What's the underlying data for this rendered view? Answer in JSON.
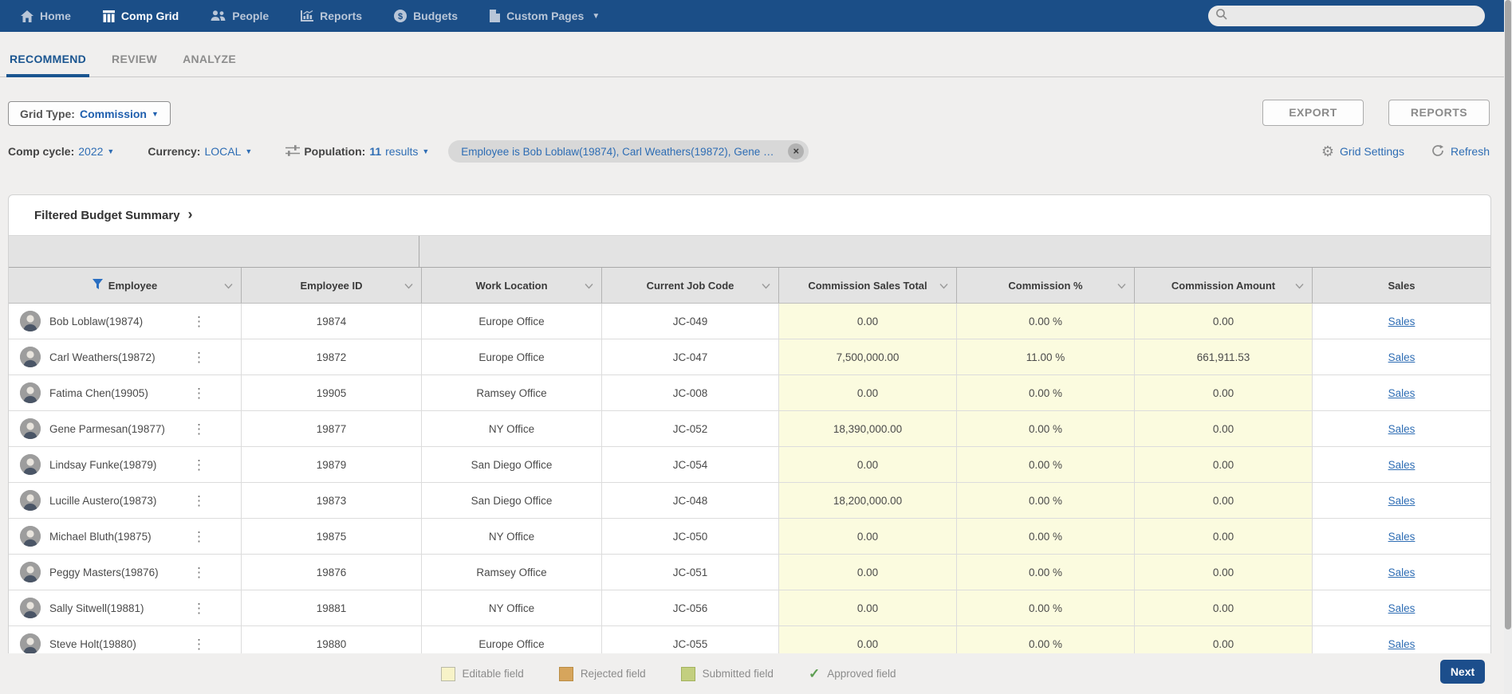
{
  "nav": {
    "items": [
      {
        "label": "Home",
        "icon": "home-icon",
        "active": false
      },
      {
        "label": "Comp Grid",
        "icon": "comp-grid-icon",
        "active": true
      },
      {
        "label": "People",
        "icon": "people-icon",
        "active": false
      },
      {
        "label": "Reports",
        "icon": "reports-icon",
        "active": false
      },
      {
        "label": "Budgets",
        "icon": "budgets-icon",
        "active": false
      },
      {
        "label": "Custom Pages",
        "icon": "custom-pages-icon",
        "active": false,
        "has_dropdown": true
      }
    ],
    "search": {
      "placeholder": "",
      "value": ""
    }
  },
  "tabs": [
    {
      "label": "RECOMMEND",
      "active": true
    },
    {
      "label": "REVIEW",
      "active": false
    },
    {
      "label": "ANALYZE",
      "active": false
    }
  ],
  "toolbar": {
    "grid_type_label": "Grid Type:",
    "grid_type_value": "Commission",
    "export_label": "EXPORT",
    "reports_label": "REPORTS"
  },
  "filters": {
    "comp_cycle_label": "Comp cycle:",
    "comp_cycle_value": "2022",
    "currency_label": "Currency:",
    "currency_value": "LOCAL",
    "population_label": "Population:",
    "population_count": "11",
    "population_results_word": "results",
    "chip_text": "Employee is Bob Loblaw(19874), Carl Weathers(19872), Gene Pa...",
    "chip_close": "×",
    "grid_settings_label": "Grid Settings",
    "refresh_label": "Refresh"
  },
  "summary": {
    "title": "Filtered Budget Summary",
    "chevron": "›"
  },
  "table": {
    "columns": [
      {
        "label": "Employee",
        "has_filter": true,
        "has_chevron": true
      },
      {
        "label": "Employee ID",
        "has_filter": false,
        "has_chevron": true
      },
      {
        "label": "Work Location",
        "has_filter": false,
        "has_chevron": true
      },
      {
        "label": "Current Job Code",
        "has_filter": false,
        "has_chevron": true
      },
      {
        "label": "Commission Sales Total",
        "has_filter": false,
        "has_chevron": true
      },
      {
        "label": "Commission %",
        "has_filter": false,
        "has_chevron": true
      },
      {
        "label": "Commission Amount",
        "has_filter": false,
        "has_chevron": true
      },
      {
        "label": "Sales",
        "has_filter": false,
        "has_chevron": false
      }
    ],
    "kebab_glyph": "⋮",
    "rows": [
      {
        "name": "Bob Loblaw(19874)",
        "id": "19874",
        "location": "Europe Office",
        "job_code": "JC-049",
        "sales_total": "0.00",
        "commission_pct": "0.00 %",
        "commission_amt": "0.00",
        "sales_label": "Sales"
      },
      {
        "name": "Carl Weathers(19872)",
        "id": "19872",
        "location": "Europe Office",
        "job_code": "JC-047",
        "sales_total": "7,500,000.00",
        "commission_pct": "11.00 %",
        "commission_amt": "661,911.53",
        "sales_label": "Sales"
      },
      {
        "name": "Fatima Chen(19905)",
        "id": "19905",
        "location": "Ramsey Office",
        "job_code": "JC-008",
        "sales_total": "0.00",
        "commission_pct": "0.00 %",
        "commission_amt": "0.00",
        "sales_label": "Sales"
      },
      {
        "name": "Gene Parmesan(19877)",
        "id": "19877",
        "location": "NY Office",
        "job_code": "JC-052",
        "sales_total": "18,390,000.00",
        "commission_pct": "0.00 %",
        "commission_amt": "0.00",
        "sales_label": "Sales"
      },
      {
        "name": "Lindsay Funke(19879)",
        "id": "19879",
        "location": "San Diego Office",
        "job_code": "JC-054",
        "sales_total": "0.00",
        "commission_pct": "0.00 %",
        "commission_amt": "0.00",
        "sales_label": "Sales"
      },
      {
        "name": "Lucille Austero(19873)",
        "id": "19873",
        "location": "San Diego Office",
        "job_code": "JC-048",
        "sales_total": "18,200,000.00",
        "commission_pct": "0.00 %",
        "commission_amt": "0.00",
        "sales_label": "Sales"
      },
      {
        "name": "Michael Bluth(19875)",
        "id": "19875",
        "location": "NY Office",
        "job_code": "JC-050",
        "sales_total": "0.00",
        "commission_pct": "0.00 %",
        "commission_amt": "0.00",
        "sales_label": "Sales"
      },
      {
        "name": "Peggy Masters(19876)",
        "id": "19876",
        "location": "Ramsey Office",
        "job_code": "JC-051",
        "sales_total": "0.00",
        "commission_pct": "0.00 %",
        "commission_amt": "0.00",
        "sales_label": "Sales"
      },
      {
        "name": "Sally Sitwell(19881)",
        "id": "19881",
        "location": "NY Office",
        "job_code": "JC-056",
        "sales_total": "0.00",
        "commission_pct": "0.00 %",
        "commission_amt": "0.00",
        "sales_label": "Sales"
      },
      {
        "name": "Steve Holt(19880)",
        "id": "19880",
        "location": "Europe Office",
        "job_code": "JC-055",
        "sales_total": "0.00",
        "commission_pct": "0.00 %",
        "commission_amt": "0.00",
        "sales_label": "Sales"
      }
    ]
  },
  "legend": {
    "items": [
      {
        "label": "Editable field",
        "type": "editable"
      },
      {
        "label": "Rejected field",
        "type": "rejected"
      },
      {
        "label": "Submitted field",
        "type": "submitted"
      },
      {
        "label": "Approved field",
        "type": "approved"
      }
    ],
    "approved_check_glyph": "✓"
  },
  "footer": {
    "next_label": "Next"
  },
  "colors": {
    "nav_background": "#1b4e87",
    "nav_inactive_text": "#b9c6d8",
    "accent_blue": "#2e6db4",
    "active_tab_blue": "#1a5590",
    "editable_cell": "#fbfbdf",
    "legend_editable": "#f7f3c8",
    "legend_rejected": "#d6a55c",
    "legend_submitted": "#c3cf7f",
    "legend_approved_check": "#5d9e52",
    "next_button": "#1c4e8c",
    "page_background": "#f0efee",
    "header_row": "#e3e3e3"
  }
}
